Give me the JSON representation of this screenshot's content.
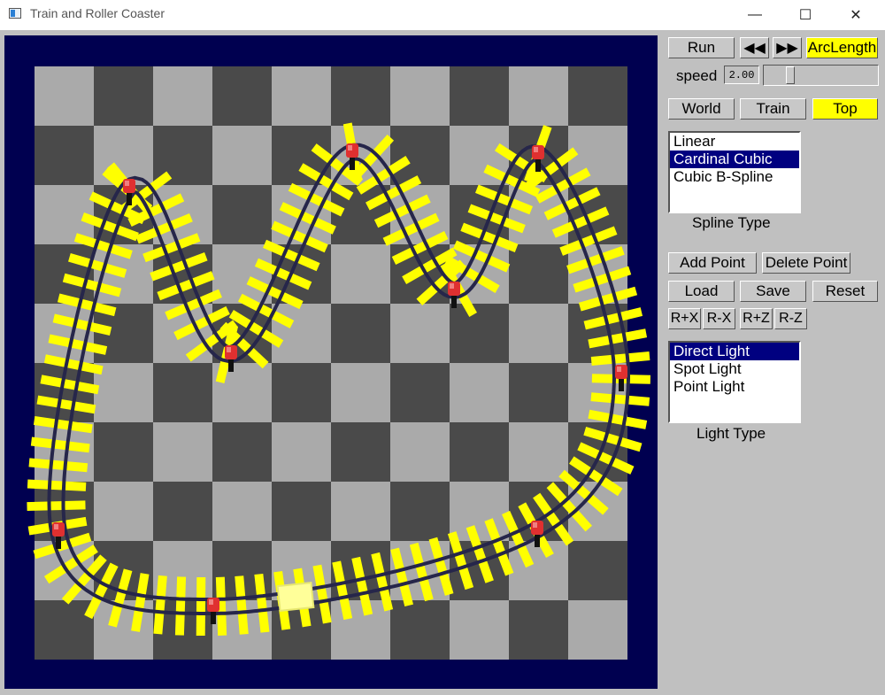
{
  "window": {
    "title": "Train and Roller Coaster",
    "minimize": "—",
    "maximize": "☐",
    "close": "✕"
  },
  "controls": {
    "run_label": "Run",
    "prev_label": "◀◀",
    "next_label": "▶▶",
    "arclength_label": "ArcLength",
    "speed_label": "speed",
    "speed_value": "2.00",
    "speed_fraction": 0.2
  },
  "views": {
    "world": "World",
    "train": "Train",
    "top": "Top",
    "selected": "top"
  },
  "spline": {
    "caption": "Spline Type",
    "options": [
      "Linear",
      "Cardinal Cubic",
      "Cubic B-Spline"
    ],
    "selected_index": 1
  },
  "edit": {
    "add_point": "Add Point",
    "delete_point": "Delete Point",
    "load": "Load",
    "save": "Save",
    "reset": "Reset",
    "rot_px": "R+X",
    "rot_mx": "R-X",
    "rot_pz": "R+Z",
    "rot_mz": "R-Z"
  },
  "light": {
    "caption": "Light Type",
    "options": [
      "Direct Light",
      "Spot Light",
      "Point Light"
    ],
    "selected_index": 0
  },
  "scene": {
    "floor_colors": [
      "#aaaaaa",
      "#4a4a4a"
    ],
    "background": "#000050",
    "track_color": "#ffff00",
    "rail_color": "#26264a",
    "control_point_color": "#e03030",
    "train_color": "#ffff99"
  }
}
